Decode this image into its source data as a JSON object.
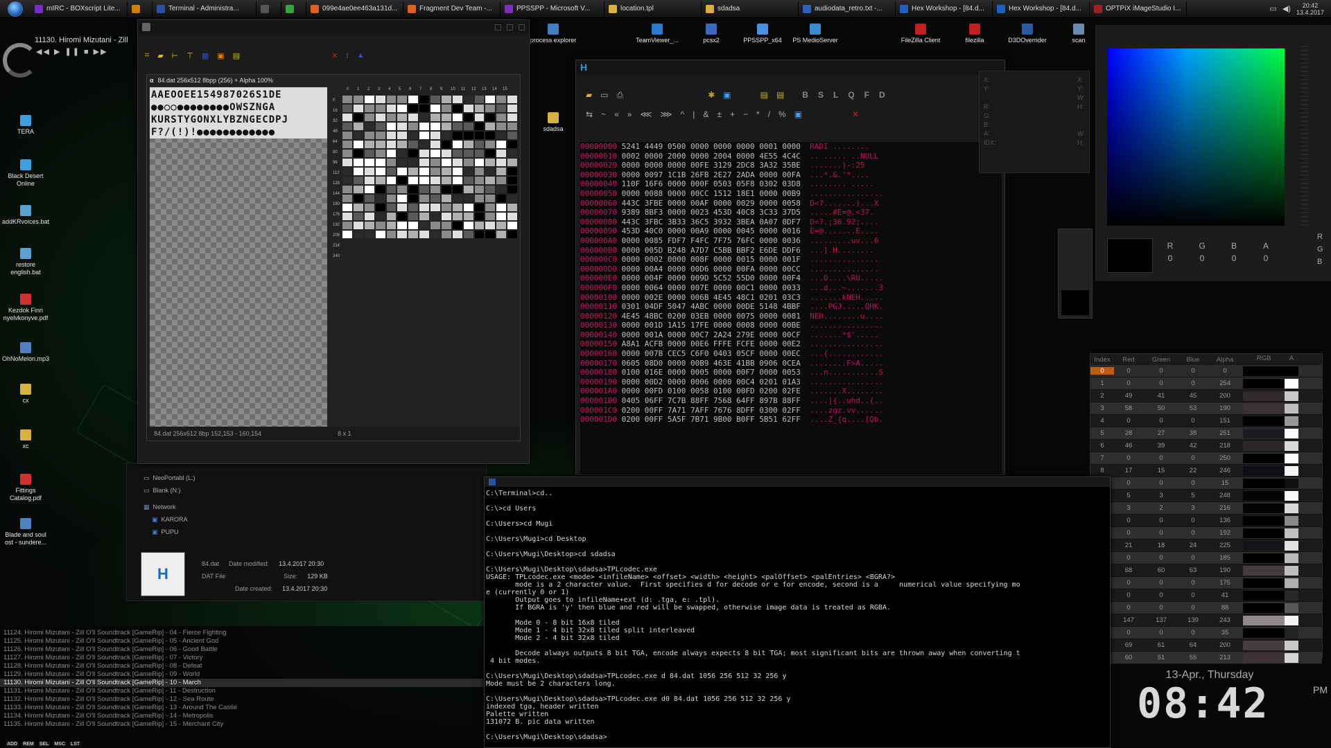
{
  "taskbar": {
    "items": [
      {
        "label": "mIRC - BOXscript Lite...",
        "color": "#7a2cc8"
      },
      {
        "label": "",
        "color": "#d08000"
      },
      {
        "label": "Terminal - Administra...",
        "color": "#2a50a0"
      },
      {
        "label": "",
        "color": "#555555"
      },
      {
        "label": "",
        "color": "#3aa040"
      },
      {
        "label": "099e4ae0ee463a131d...",
        "color": "#e06020"
      },
      {
        "label": "Fragment Dev Team -...",
        "color": "#e06020"
      },
      {
        "label": "PPSSPP - Microsoft V...",
        "color": "#8030c0"
      },
      {
        "label": "location.tpl",
        "color": "#d8b040"
      },
      {
        "label": "sdadsa",
        "color": "#d8b040"
      },
      {
        "label": "audiodata_retro.txt -...",
        "color": "#3060c0"
      },
      {
        "label": "Hex Workshop - [84.d...",
        "color": "#2060c0"
      },
      {
        "label": "Hex Workshop - [84.d...",
        "color": "#2060c0"
      },
      {
        "label": "OPTPiX iMageStudio I...",
        "color": "#a02020"
      }
    ],
    "clock_time": "20:42",
    "clock_date": "13.4.2017"
  },
  "player": {
    "title": "11130. Hiromi Mizutani - Zill",
    "controls": "◀◀ ▶ ❚❚ ■ ▶▶"
  },
  "desktop_icons": [
    {
      "label": "TERA"
    },
    {
      "label": "Black Desert Online"
    },
    {
      "label": "addKRvoices.bat"
    },
    {
      "label": "restore english.bat"
    },
    {
      "label": "Kezdok Finn nyelvkonyve.pdf"
    },
    {
      "label": "OhNoMelon.mp3"
    },
    {
      "label": "cx"
    },
    {
      "label": "xc"
    },
    {
      "label": "Fittings Catalog.pdf"
    },
    {
      "label": "Blade and soul ost - sundere..."
    }
  ],
  "top_icons": [
    {
      "label": "process explorer"
    },
    {
      "label": "TeamViewer_..."
    },
    {
      "label": "pcsx2"
    },
    {
      "label": "PPSSPP_x64"
    },
    {
      "label": "PS MedioServer"
    },
    {
      "label": "FileZilla Client"
    },
    {
      "label": "filezilla"
    },
    {
      "label": "D3DOverrider"
    },
    {
      "label": "scan"
    }
  ],
  "folder_icon": {
    "label": "sdadsa"
  },
  "image_editor": {
    "canvas_title": "84.dat   256x512   8bpp (256) + Alpha   100%",
    "glyphs": "AAEOOEE154987026S1DE ●●○○●●●●●●●●OWSZNGA KURSTYGONXLYBZNGECDPJ F?/(!)!●●●●●●●●●●●●",
    "pal_axis": [
      "0",
      "1",
      "2",
      "3",
      "4",
      "5",
      "6",
      "7",
      "8",
      "9",
      "10",
      "11",
      "12",
      "13",
      "14",
      "15"
    ],
    "pal_rows": [
      "0",
      "16",
      "32",
      "48",
      "64",
      "80",
      "96",
      "112",
      "128",
      "144",
      "160",
      "176",
      "192",
      "208",
      "224",
      "240"
    ],
    "status_file": "84.dat   256x512   8bp   152,153 - 160,154",
    "status_zoom": "8 x 1"
  },
  "explorer": {
    "drives": [
      {
        "label": "NeoPortabl (L:)"
      },
      {
        "label": "Blank (N:)"
      }
    ],
    "network_label": "Network",
    "network_items": [
      {
        "label": "KARORA"
      },
      {
        "label": "PUPU"
      }
    ],
    "file": {
      "name": "84.dat",
      "type": "DAT File",
      "modified_label": "Date modified:",
      "modified": "13.4.2017 20:30",
      "size_label": "Size:",
      "size": "129 KB",
      "created_label": "Date created:",
      "created": "13.4.2017 20:30"
    }
  },
  "hex_workshop": {
    "toolbar_letters": [
      "B",
      "S",
      "L",
      "Q",
      "F",
      "D"
    ],
    "lines": [
      {
        "off": "00000000",
        "hex": "5241 4449 0500 0000 0000 0000 0001 0000",
        "asc": "RADI ........"
      },
      {
        "off": "00000010",
        "hex": "0002 0000 2000 0000 2004 0000 4E55 4C4C",
        "asc": ".. ..... ..NULL"
      },
      {
        "off": "00000020",
        "hex": "0000 0000 0000 00FE 3129 2DC8 3A32 35BE",
        "asc": ".......)-:25"
      },
      {
        "off": "00000030",
        "hex": "0000 0097 1C1B 26FB 2E27 2ADA 0000 00FA",
        "asc": "...*.&.'*...."
      },
      {
        "off": "00000040",
        "hex": "110F 16F6 0000 000F 0503 05F8 0302 03D8",
        "asc": "........ ....."
      },
      {
        "off": "00000050",
        "hex": "0000 0088 0000 00CC 1512 18E1 0000 00B9",
        "asc": "................"
      },
      {
        "off": "00000060",
        "hex": "443C 3FBE 0000 00AF 0000 0029 0000 0058",
        "asc": "D<?.......)...X"
      },
      {
        "off": "00000070",
        "hex": "9389 8BF3 0000 0023 453D 40C8 3C33 37D5",
        "asc": ".....#E=@.<37."
      },
      {
        "off": "00000080",
        "hex": "443C 3FBC 3B33 36C5 3932 3BEA 0A07 0DF7",
        "asc": "D<?.;36.92;...."
      },
      {
        "off": "00000090",
        "hex": "453D 40C0 0000 00A9 0000 0045 0000 0016",
        "asc": "E=@.......E...."
      },
      {
        "off": "000000A0",
        "hex": "0000 0085 FDF7 F4FC 7F75 76FC 0000 0036",
        "asc": ".........uv...6"
      },
      {
        "off": "000000B0",
        "hex": "0000 005D B248 A7D7 C5BB BBF2 E6DE DDF6",
        "asc": "...].H........"
      },
      {
        "off": "000000C0",
        "hex": "0000 0002 0000 008F 0000 0015 0000 001F",
        "asc": "..............."
      },
      {
        "off": "000000D0",
        "hex": "0000 00A4 0000 00D6 0000 00FA 0000 00CC",
        "asc": "..............."
      },
      {
        "off": "000000E0",
        "hex": "0000 004F 0000 009D 5C52 55D0 0000 00F4",
        "asc": "...O....\\RU....."
      },
      {
        "off": "000000F0",
        "hex": "0000 0064 0000 007E 0000 00C1 0000 0033",
        "asc": "...d...~.......3"
      },
      {
        "off": "00000100",
        "hex": "0000 002E 0000 006B 4E45 48C1 0201 03C3",
        "asc": ".......kNEH....."
      },
      {
        "off": "00000110",
        "hex": "0301 04DF 5047 4ABC 0000 00DE 5148 4BBF",
        "asc": "....PGJ.....QHK."
      },
      {
        "off": "00000120",
        "hex": "4E45 48BC 0200 03EB 0000 0075 0000 0081",
        "asc": "NEH........u...."
      },
      {
        "off": "00000130",
        "hex": "0000 001D 1A15 17FE 0000 0008 0000 00BE",
        "asc": "................"
      },
      {
        "off": "00000140",
        "hex": "0000 001A 0000 00C7 2A24 279E 0000 00CF",
        "asc": ".......*$'....."
      },
      {
        "off": "00000150",
        "hex": "A8A1 ACFB 0000 00E6 FFFE FCFE 0000 00E2",
        "asc": "................"
      },
      {
        "off": "00000160",
        "hex": "0000 007B CEC5 C6F0 0403 05CF 0000 00EC",
        "asc": "...{............"
      },
      {
        "off": "00000170",
        "hex": "0605 08D0 0000 00B9 463E 41BB 0906 0CEA",
        "asc": "........F>A....."
      },
      {
        "off": "00000180",
        "hex": "0100 016E 0000 0005 0000 00F7 0000 0053",
        "asc": "...n...........S"
      },
      {
        "off": "00000190",
        "hex": "0000 00D2 0000 0006 0000 00C4 0201 01A3",
        "asc": "................"
      },
      {
        "off": "000001A0",
        "hex": "0000 00FD 0100 0058 0100 00FD 0200 02FE",
        "asc": ".......X........"
      },
      {
        "off": "000001B0",
        "hex": "0405 06FF 7C7B 88FF 7568 64FF 897B 88FF",
        "asc": "....|{..uhd..{.."
      },
      {
        "off": "000001C0",
        "hex": "0200 00FF 7A71 7AFF 7676 8DFF 0300 02FF",
        "asc": "....zqz.vv......"
      },
      {
        "off": "000001D0",
        "hex": "0200 00FF 5A5F 7B71 9B00 B0FF 5B51 62FF",
        "asc": "....Z_{q....[Qb."
      }
    ]
  },
  "inspector": {
    "labels_left": [
      "X:",
      "Y:",
      "",
      "R:",
      "G:",
      "B:",
      "A:",
      "IDX:"
    ],
    "labels_right": [
      "X:",
      "Y:",
      "W:",
      "H:",
      "",
      "",
      "W:",
      "H:"
    ]
  },
  "color_picker": {
    "labels": [
      "R",
      "G",
      "B",
      "A"
    ],
    "values": [
      "0",
      "0",
      "0",
      "0"
    ],
    "side_labels": [
      "R",
      "G",
      "B"
    ]
  },
  "palette_table": {
    "headers": [
      "Index",
      "Red",
      "Green",
      "Blue",
      "Alpha",
      "RGB",
      "A"
    ],
    "rows": [
      {
        "i": "0",
        "r": "0",
        "g": "0",
        "b": "0",
        "a": "0",
        "rgb": "#000000",
        "al": "#000000"
      },
      {
        "i": "1",
        "r": "0",
        "g": "0",
        "b": "0",
        "a": "254",
        "rgb": "#000000",
        "al": "#fefefe"
      },
      {
        "i": "2",
        "r": "49",
        "g": "41",
        "b": "45",
        "a": "200",
        "rgb": "#31292d",
        "al": "#c8c8c8"
      },
      {
        "i": "3",
        "r": "58",
        "g": "50",
        "b": "53",
        "a": "190",
        "rgb": "#3a3235",
        "al": "#bebebe"
      },
      {
        "i": "4",
        "r": "0",
        "g": "0",
        "b": "0",
        "a": "151",
        "rgb": "#000000",
        "al": "#979797"
      },
      {
        "i": "5",
        "r": "28",
        "g": "27",
        "b": "38",
        "a": "251",
        "rgb": "#1c1b26",
        "al": "#fbfbfb"
      },
      {
        "i": "6",
        "r": "46",
        "g": "39",
        "b": "42",
        "a": "218",
        "rgb": "#2e272a",
        "al": "#dadada"
      },
      {
        "i": "7",
        "r": "0",
        "g": "0",
        "b": "0",
        "a": "250",
        "rgb": "#000000",
        "al": "#fafafa"
      },
      {
        "i": "8",
        "r": "17",
        "g": "15",
        "b": "22",
        "a": "246",
        "rgb": "#110f16",
        "al": "#f6f6f6"
      },
      {
        "i": "",
        "r": "0",
        "g": "0",
        "b": "0",
        "a": "15",
        "rgb": "#000000",
        "al": "#0f0f0f"
      },
      {
        "i": "",
        "r": "5",
        "g": "3",
        "b": "5",
        "a": "248",
        "rgb": "#050305",
        "al": "#f8f8f8"
      },
      {
        "i": "",
        "r": "3",
        "g": "2",
        "b": "3",
        "a": "216",
        "rgb": "#030203",
        "al": "#d8d8d8"
      },
      {
        "i": "",
        "r": "0",
        "g": "0",
        "b": "0",
        "a": "136",
        "rgb": "#000000",
        "al": "#888888"
      },
      {
        "i": "",
        "r": "0",
        "g": "0",
        "b": "0",
        "a": "192",
        "rgb": "#000000",
        "al": "#c0c0c0"
      },
      {
        "i": "",
        "r": "21",
        "g": "18",
        "b": "24",
        "a": "225",
        "rgb": "#151218",
        "al": "#e1e1e1"
      },
      {
        "i": "",
        "r": "0",
        "g": "0",
        "b": "0",
        "a": "185",
        "rgb": "#000000",
        "al": "#b9b9b9"
      },
      {
        "i": "",
        "r": "68",
        "g": "60",
        "b": "63",
        "a": "190",
        "rgb": "#443c3f",
        "al": "#bebebe"
      },
      {
        "i": "",
        "r": "0",
        "g": "0",
        "b": "0",
        "a": "175",
        "rgb": "#000000",
        "al": "#afafaf"
      },
      {
        "i": "",
        "r": "0",
        "g": "0",
        "b": "0",
        "a": "41",
        "rgb": "#000000",
        "al": "#292929"
      },
      {
        "i": "",
        "r": "0",
        "g": "0",
        "b": "0",
        "a": "88",
        "rgb": "#000000",
        "al": "#585858"
      },
      {
        "i": "",
        "r": "147",
        "g": "137",
        "b": "139",
        "a": "243",
        "rgb": "#93898b",
        "al": "#f3f3f3"
      },
      {
        "i": "",
        "r": "0",
        "g": "0",
        "b": "0",
        "a": "35",
        "rgb": "#000000",
        "al": "#232323"
      },
      {
        "i": "",
        "r": "69",
        "g": "61",
        "b": "64",
        "a": "200",
        "rgb": "#453d40",
        "al": "#c8c8c8"
      },
      {
        "i": "",
        "r": "60",
        "g": "51",
        "b": "55",
        "a": "213",
        "rgb": "#3c3337",
        "al": "#d5d5d5"
      }
    ]
  },
  "playlist": {
    "rows": [
      "11124. Hiromi Mizutani - Zill O'll Soundtrack [GameRip] - 04 - Fierce Fighting",
      "11125. Hiromi Mizutani - Zill O'll Soundtrack [GameRip] - 05 - Ancient God",
      "11126. Hiromi Mizutani - Zill O'll Soundtrack [GameRip] - 06 - Good Battle",
      "11127. Hiromi Mizutani - Zill O'll Soundtrack [GameRip] - 07 - Victory",
      "11128. Hiromi Mizutani - Zill O'll Soundtrack [GameRip] - 08 - Defeat",
      "11129. Hiromi Mizutani - Zill O'll Soundtrack [GameRip] - 09 - World",
      "11130. Hiromi Mizutani - Zill O'll Soundtrack [GameRip] - 10 - March",
      "11131. Hiromi Mizutani - Zill O'll Soundtrack [GameRip] - 11 - Destruction",
      "11132. Hiromi Mizutani - Zill O'll Soundtrack [GameRip] - 12 - Sea Route",
      "11133. Hiromi Mizutani - Zill O'll Soundtrack [GameRip] - 13 - Around The Castle",
      "11134. Hiromi Mizutani - Zill O'll Soundtrack [GameRip] - 14 - Metropolis",
      "11135. Hiromi Mizutani - Zill O'll Soundtrack [GameRip] - 15 - Merchant City"
    ],
    "current_index": 6,
    "buttons": [
      "ADD",
      "REM",
      "SEL",
      "MSC",
      "LST"
    ]
  },
  "terminal": {
    "lines": [
      "C:\\Terminal>cd..",
      "",
      "C:\\>cd Users",
      "",
      "C:\\Users>cd Mugi",
      "",
      "C:\\Users\\Mugi>cd Desktop",
      "",
      "C:\\Users\\Mugi\\Desktop>cd sdadsa",
      "",
      "C:\\Users\\Mugi\\Desktop\\sdadsa>TPLcodec.exe",
      "USAGE: TPLcodec.exe <mode> <infileName> <offset> <width> <height> <palOffset> <palEntries> <BGRA?>",
      "       mode is a 2 character value.  First specifies d for decode or e for encode, second is a     numerical value specifying mo",
      "e (currently 0 or 1)",
      "       Output goes to infileName+ext (d: .tga, e: .tpl).",
      "       If BGRA is 'y' then blue and red will be swapped, otherwise image data is treated as RGBA.",
      "",
      "       Mode 0 - 8 bit 16x8 tiled",
      "       Mode 1 - 4 bit 32x8 tiled split interleaved",
      "       Mode 2 - 4 bit 32x8 tiled",
      "",
      "       Decode always outputs 8 bit TGA, encode always expects 8 bit TGA; most significant bits are thrown away when converting t",
      " 4 bit modes.",
      "",
      "C:\\Users\\Mugi\\Desktop\\sdadsa>TPLcodec.exe d 84.dat 1056 256 512 32 256 y",
      "Mode must be 2 characters long.",
      "",
      "C:\\Users\\Mugi\\Desktop\\sdadsa>TPLcodec.exe d0 84.dat 1056 256 512 32 256 y",
      "indexed tga, header written",
      "Palette written",
      "131072 B. pic data written",
      "",
      "C:\\Users\\Mugi\\Desktop\\sdadsa>"
    ]
  },
  "big_clock": {
    "date": "13-Apr., Thursday",
    "time": "08:42",
    "ampm": "PM"
  }
}
